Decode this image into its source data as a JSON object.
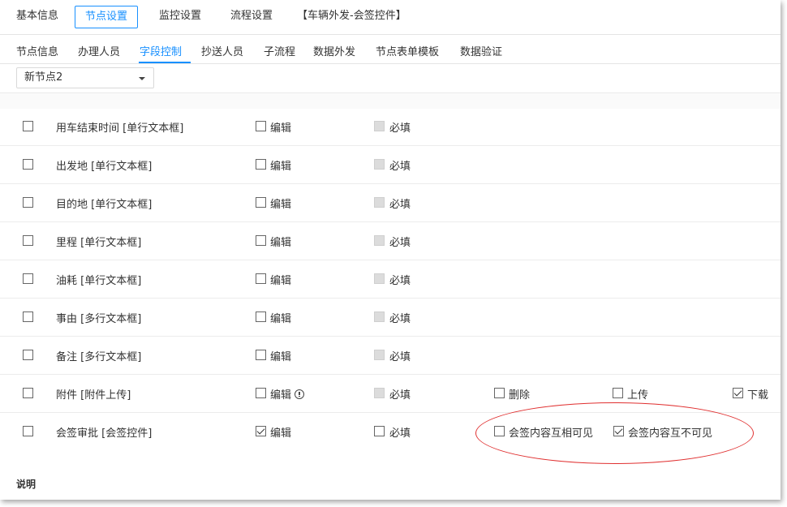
{
  "top_tabs": [
    "基本信息",
    "节点设置",
    "监控设置",
    "流程设置",
    "【车辆外发-会签控件】"
  ],
  "active_top_tab": 1,
  "sub_tabs": [
    "节点信息",
    "办理人员",
    "字段控制",
    "抄送人员",
    "子流程",
    "数据外发",
    "节点表单模板",
    "数据验证"
  ],
  "active_sub_tab": 2,
  "node_select": {
    "value": "新节点2"
  },
  "labels": {
    "edit": "编辑",
    "required": "必填",
    "delete": "删除",
    "upload": "上传",
    "download": "下载",
    "countersign_visible": "会签内容互相可见",
    "countersign_invisible": "会签内容互不可见"
  },
  "fields": [
    {
      "name": "用车结束时间 [单行文本框]",
      "selected": false,
      "edit": false,
      "required": false,
      "required_disabled": true
    },
    {
      "name": "出发地 [单行文本框]",
      "selected": false,
      "edit": false,
      "required": false,
      "required_disabled": true
    },
    {
      "name": "目的地 [单行文本框]",
      "selected": false,
      "edit": false,
      "required": false,
      "required_disabled": true
    },
    {
      "name": "里程 [单行文本框]",
      "selected": false,
      "edit": false,
      "required": false,
      "required_disabled": true
    },
    {
      "name": "油耗 [单行文本框]",
      "selected": false,
      "edit": false,
      "required": false,
      "required_disabled": true
    },
    {
      "name": "事由 [多行文本框]",
      "selected": false,
      "edit": false,
      "required": false,
      "required_disabled": true
    },
    {
      "name": "备注 [多行文本框]",
      "selected": false,
      "edit": false,
      "required": false,
      "required_disabled": true
    },
    {
      "name": "附件 [附件上传]",
      "selected": false,
      "edit": false,
      "edit_info_icon": true,
      "required": false,
      "required_disabled": true,
      "delete": false,
      "upload": false,
      "download": true
    },
    {
      "name": "会签审批 [会签控件]",
      "selected": false,
      "edit": true,
      "required": false,
      "required_disabled": false,
      "countersign_visible": false,
      "countersign_invisible": true
    }
  ],
  "footer": {
    "note_label": "说明"
  },
  "colors": {
    "accent": "#1890ff",
    "annotation": "#e03030"
  }
}
